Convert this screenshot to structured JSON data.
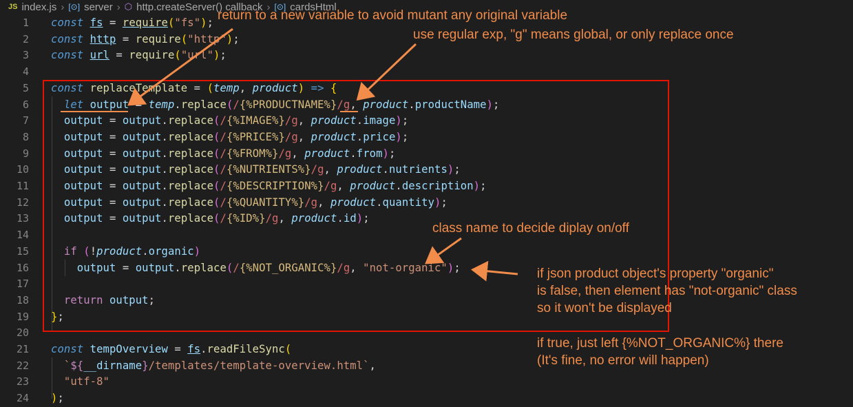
{
  "breadcrumb": {
    "file_badge": "JS",
    "file": "index.js",
    "sep": "›",
    "item1": "server",
    "item2": "http.createServer() callback",
    "item3": "cardsHtml"
  },
  "annotations": {
    "return_note": "return to a new variable to avoid mutant any original variable",
    "regex_note": "use regular exp, \"g\" means global, or only replace once",
    "class_note": "class name to decide diplay on/off",
    "organic_note_1": "if json product object's property \"organic\"",
    "organic_note_2": "is false, then element has \"not-organic\" class",
    "organic_note_3": "so it won't be displayed",
    "true_note_1": "if true, just left {%NOT_ORGANIC%} there",
    "true_note_2": "(It's fine, no error will happen)"
  },
  "line_numbers": [
    "1",
    "2",
    "3",
    "4",
    "5",
    "6",
    "7",
    "8",
    "9",
    "10",
    "11",
    "12",
    "13",
    "14",
    "15",
    "16",
    "17",
    "18",
    "19",
    "20",
    "21",
    "22",
    "23",
    "24"
  ],
  "colors": {
    "annotation": "#f28c4a",
    "highlight_box": "#e51400",
    "background": "#1e1e1e"
  }
}
